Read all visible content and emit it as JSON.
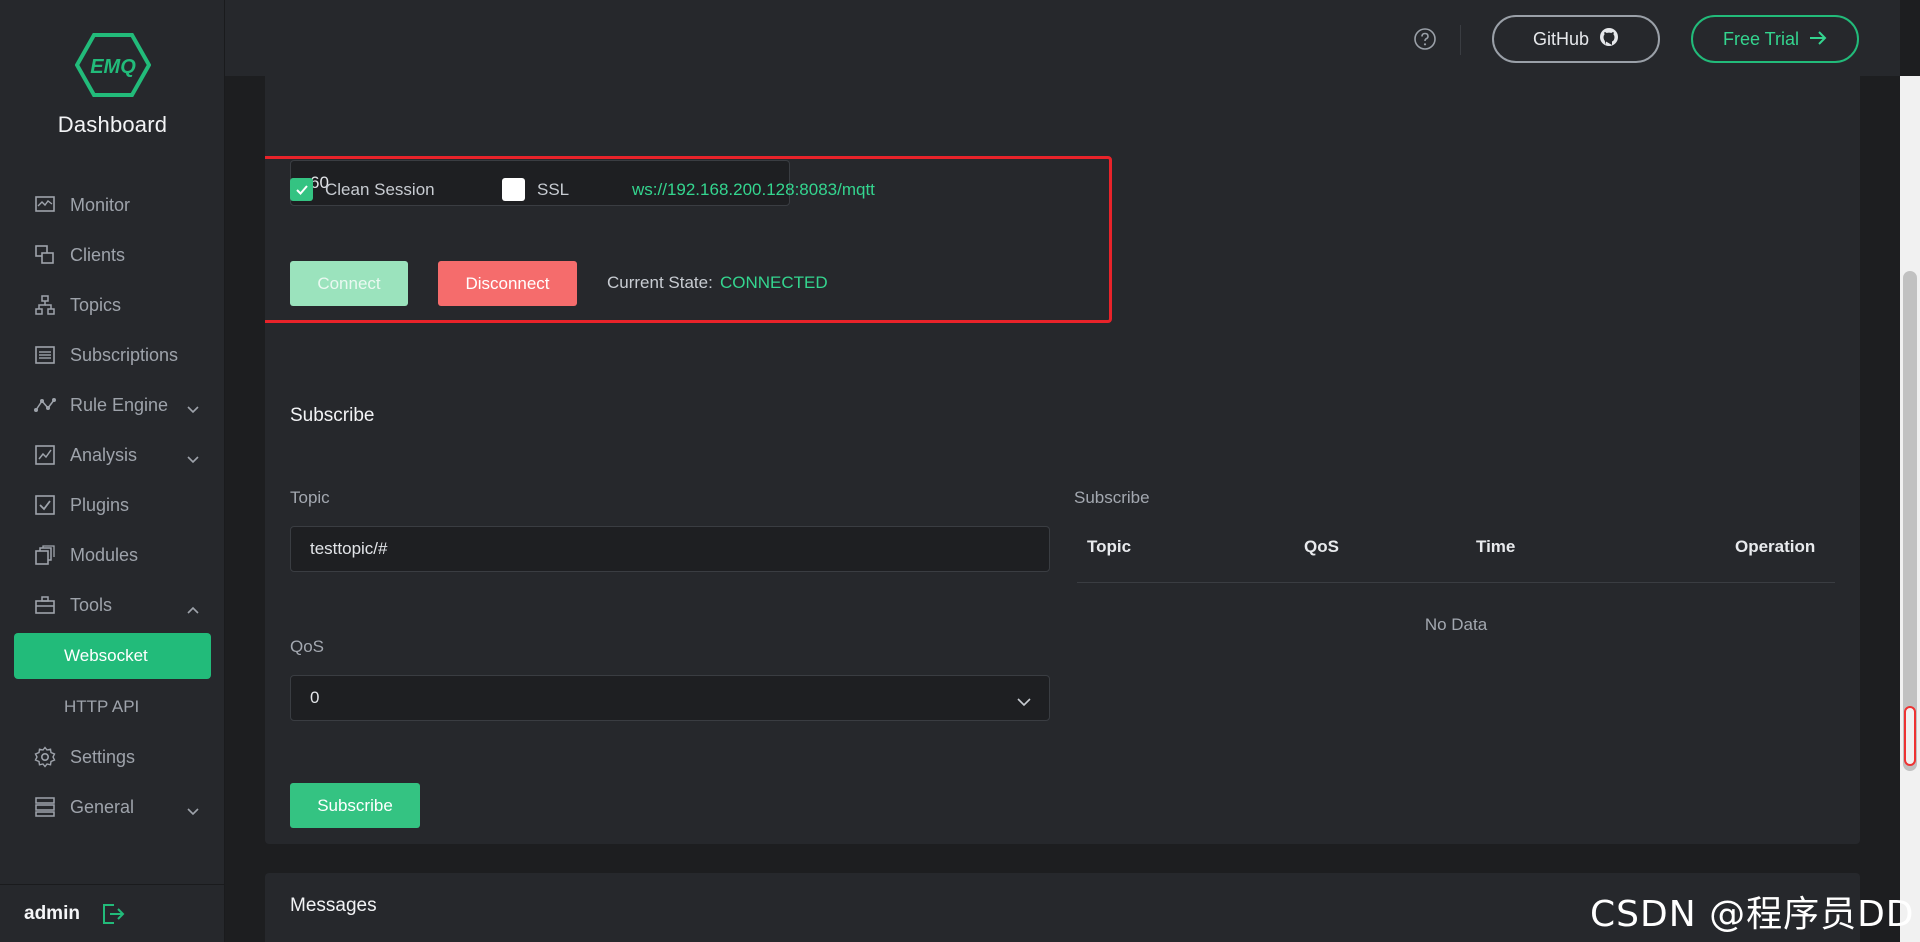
{
  "sidebar": {
    "brand": "Dashboard",
    "logo_text": "EMQ",
    "items": [
      {
        "label": "Monitor",
        "icon": "monitor-icon"
      },
      {
        "label": "Clients",
        "icon": "clients-icon"
      },
      {
        "label": "Topics",
        "icon": "topics-icon"
      },
      {
        "label": "Subscriptions",
        "icon": "subscriptions-icon"
      },
      {
        "label": "Rule Engine",
        "icon": "rule-engine-icon"
      },
      {
        "label": "Analysis",
        "icon": "analysis-icon"
      },
      {
        "label": "Plugins",
        "icon": "plugins-icon"
      },
      {
        "label": "Modules",
        "icon": "modules-icon"
      },
      {
        "label": "Tools",
        "icon": "tools-icon"
      },
      {
        "label": "Settings",
        "icon": "settings-icon"
      },
      {
        "label": "General",
        "icon": "general-icon"
      }
    ],
    "tools_sub": [
      {
        "label": "Websocket",
        "active": true
      },
      {
        "label": "HTTP API",
        "active": false
      }
    ],
    "user": "admin"
  },
  "header": {
    "github_label": "GitHub",
    "trial_label": "Free Trial"
  },
  "connection": {
    "keepalive_value": "60",
    "clean_session_label": "Clean Session",
    "clean_session_checked": true,
    "ssl_label": "SSL",
    "ssl_checked": false,
    "ws_url": "ws://192.168.200.128:8083/mqtt",
    "connect_label": "Connect",
    "disconnect_label": "Disconnect",
    "state_label": "Current State:",
    "state_value": "CONNECTED"
  },
  "subscribe": {
    "title": "Subscribe",
    "topic_label": "Topic",
    "topic_value": "testtopic/#",
    "qos_label": "QoS",
    "qos_value": "0",
    "button_label": "Subscribe",
    "table_title": "Subscribe",
    "columns": [
      "Topic",
      "QoS",
      "Time",
      "Operation"
    ],
    "empty_text": "No Data"
  },
  "messages": {
    "title": "Messages"
  },
  "watermark": "CSDN @程序员DD",
  "colors": {
    "accent": "#22bb7a",
    "danger": "#f56c6c",
    "sidebar_bg": "#26282c",
    "page_bg": "#1d1e20"
  }
}
